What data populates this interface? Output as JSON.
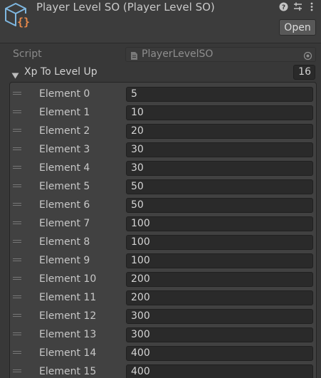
{
  "header": {
    "title": "Player Level SO (Player Level SO)",
    "open_label": "Open",
    "icons": [
      "scriptable-object-icon",
      "help-icon",
      "preset-settings-icon",
      "kebab-menu-icon"
    ]
  },
  "script": {
    "label": "Script",
    "value": "PlayerLevelSO"
  },
  "xp_list": {
    "label": "Xp To Level Up",
    "size": "16",
    "elements": [
      {
        "label": "Element 0",
        "value": "5"
      },
      {
        "label": "Element 1",
        "value": "10"
      },
      {
        "label": "Element 2",
        "value": "20"
      },
      {
        "label": "Element 3",
        "value": "30"
      },
      {
        "label": "Element 4",
        "value": "30"
      },
      {
        "label": "Element 5",
        "value": "50"
      },
      {
        "label": "Element 6",
        "value": "50"
      },
      {
        "label": "Element 7",
        "value": "100"
      },
      {
        "label": "Element 8",
        "value": "100"
      },
      {
        "label": "Element 9",
        "value": "100"
      },
      {
        "label": "Element 10",
        "value": "200"
      },
      {
        "label": "Element 11",
        "value": "200"
      },
      {
        "label": "Element 12",
        "value": "300"
      },
      {
        "label": "Element 13",
        "value": "300"
      },
      {
        "label": "Element 14",
        "value": "400"
      },
      {
        "label": "Element 15",
        "value": "400"
      }
    ]
  },
  "colors": {
    "background": "#383838",
    "field": "#2a2a2a",
    "icon_blue": "#7fb7e0",
    "icon_orange": "#e8894a"
  }
}
